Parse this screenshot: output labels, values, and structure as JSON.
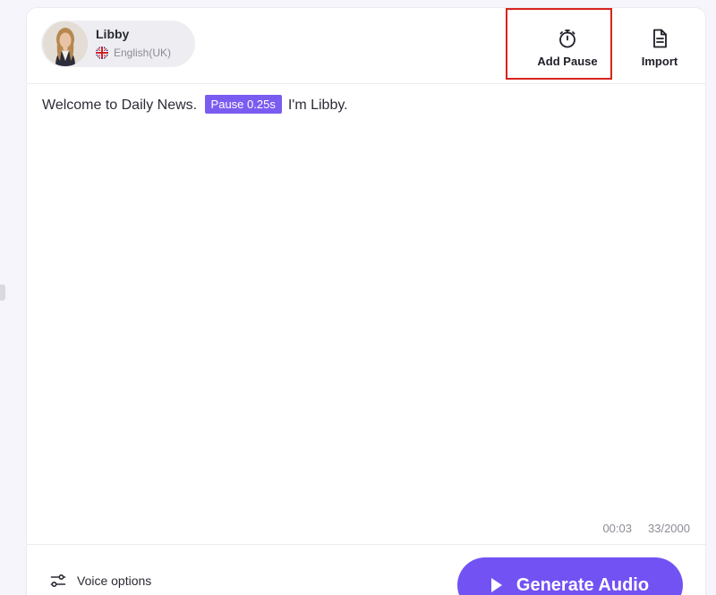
{
  "voice": {
    "name": "Libby",
    "language": "English(UK)",
    "flag_icon": "uk-flag-icon",
    "avatar_icon": "avatar"
  },
  "toolbar": {
    "add_pause_label": "Add Pause",
    "add_pause_icon": "stopwatch-icon",
    "import_label": "Import",
    "import_icon": "document-icon"
  },
  "editor": {
    "text_before": "Welcome to Daily News.",
    "pause_tag": "Pause 0.25s",
    "text_after": "I'm Libby."
  },
  "stats": {
    "duration": "00:03",
    "char_count": "33/2000"
  },
  "footer": {
    "voice_options_label": "Voice options",
    "voice_options_icon": "sliders-icon",
    "generate_label": "Generate Audio",
    "generate_icon": "play-icon"
  },
  "colors": {
    "accent": "#7352f4",
    "pause_tag": "#7b5cf0",
    "highlight": "#d8231d"
  }
}
